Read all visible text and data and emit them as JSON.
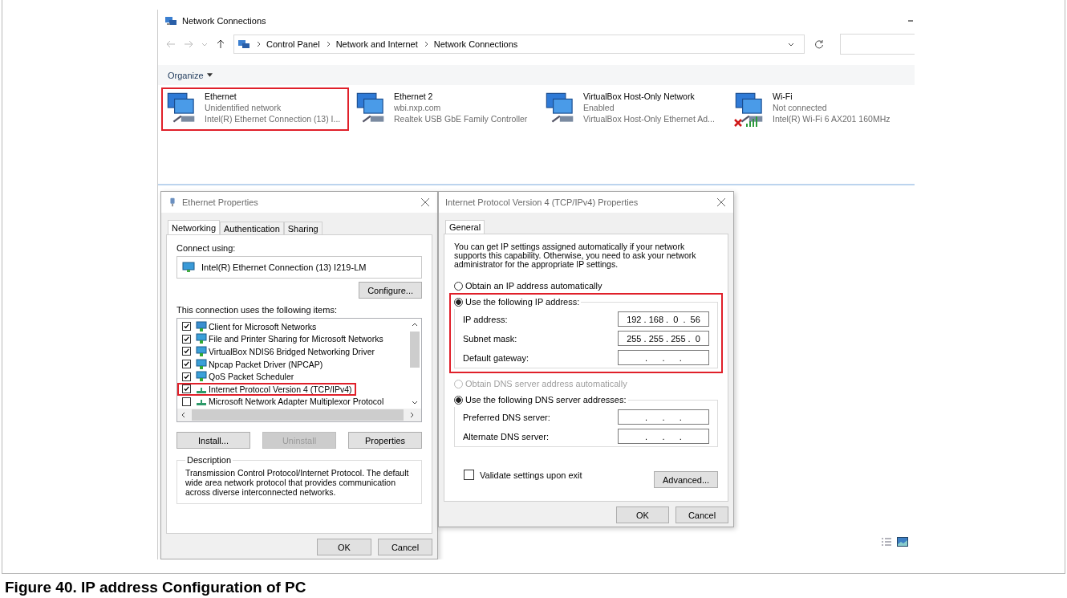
{
  "explorer": {
    "title": "Network Connections",
    "breadcrumb": [
      "Control Panel",
      "Network and Internet",
      "Network Connections"
    ],
    "organize": "Organize",
    "connections": [
      {
        "name": "Ethernet",
        "status": "Unidentified network",
        "device": "Intel(R) Ethernet Connection (13) I...",
        "kind": "wired",
        "disconnected": false,
        "highlighted": true
      },
      {
        "name": "Ethernet 2",
        "status": "wbi.nxp.com",
        "device": "Realtek USB GbE Family Controller",
        "kind": "wired",
        "disconnected": false,
        "highlighted": false
      },
      {
        "name": "VirtualBox Host-Only Network",
        "status": "Enabled",
        "device": "VirtualBox Host-Only Ethernet Ad...",
        "kind": "wired",
        "disconnected": false,
        "highlighted": false
      },
      {
        "name": "Wi-Fi",
        "status": "Not connected",
        "device": "Intel(R) Wi-Fi 6 AX201 160MHz",
        "kind": "wireless",
        "disconnected": true,
        "highlighted": false
      }
    ]
  },
  "ethernet_properties": {
    "title": "Ethernet Properties",
    "tabs": [
      {
        "label": "Networking",
        "selected": true
      },
      {
        "label": "Authentication",
        "selected": false
      },
      {
        "label": "Sharing",
        "selected": false
      }
    ],
    "connect_using": "Connect using:",
    "adapter": "Intel(R) Ethernet Connection (13) I219-LM",
    "configure": "Configure...",
    "items_label": "This connection uses the following items:",
    "items": [
      {
        "label": "Client for Microsoft Networks",
        "checked": true,
        "kind": "client",
        "highlighted": false
      },
      {
        "label": "File and Printer Sharing for Microsoft Networks",
        "checked": true,
        "kind": "service",
        "highlighted": false
      },
      {
        "label": "VirtualBox NDIS6 Bridged Networking Driver",
        "checked": true,
        "kind": "service",
        "highlighted": false
      },
      {
        "label": "Npcap Packet Driver (NPCAP)",
        "checked": true,
        "kind": "service",
        "highlighted": false
      },
      {
        "label": "QoS Packet Scheduler",
        "checked": true,
        "kind": "service",
        "highlighted": false
      },
      {
        "label": "Internet Protocol Version 4 (TCP/IPv4)",
        "checked": true,
        "kind": "protocol",
        "highlighted": true
      },
      {
        "label": "Microsoft Network Adapter Multiplexor Protocol",
        "checked": false,
        "kind": "protocol",
        "highlighted": false
      }
    ],
    "buttons": [
      {
        "label": "Install...",
        "disabled": false
      },
      {
        "label": "Uninstall",
        "disabled": true
      },
      {
        "label": "Properties",
        "disabled": false
      }
    ],
    "description_label": "Description",
    "description": "Transmission Control Protocol/Internet Protocol. The default wide area network protocol that provides communication across diverse interconnected networks.",
    "ok": "OK",
    "cancel": "Cancel"
  },
  "ipv4_properties": {
    "title": "Internet Protocol Version 4 (TCP/IPv4) Properties",
    "tab": "General",
    "intro": "You can get IP settings assigned automatically if your network supports this capability. Otherwise, you need to ask your network administrator for the appropriate IP settings.",
    "ip_auto": {
      "label": "Obtain an IP address automatically",
      "selected": false,
      "disabled": false
    },
    "ip_manual": {
      "label": "Use the following IP address:",
      "selected": true,
      "highlighted": true,
      "fields": [
        {
          "label": "IP address:",
          "value": "192 . 168 .  0  .  56"
        },
        {
          "label": "Subnet mask:",
          "value": "255 . 255 . 255 .  0"
        },
        {
          "label": "Default gateway:",
          "value": "   .      .      .   "
        }
      ]
    },
    "dns_auto": {
      "label": "Obtain DNS server address automatically",
      "selected": false,
      "disabled": true
    },
    "dns_manual": {
      "label": "Use the following DNS server addresses:",
      "selected": true,
      "highlighted": false,
      "fields": [
        {
          "label": "Preferred DNS server:",
          "value": "   .      .      .   "
        },
        {
          "label": "Alternate DNS server:",
          "value": "   .      .      .   "
        }
      ]
    },
    "validate": {
      "label": "Validate settings upon exit",
      "checked": false
    },
    "advanced": "Advanced...",
    "ok": "OK",
    "cancel": "Cancel"
  },
  "caption": "Figure 40.  IP address Configuration of PC"
}
